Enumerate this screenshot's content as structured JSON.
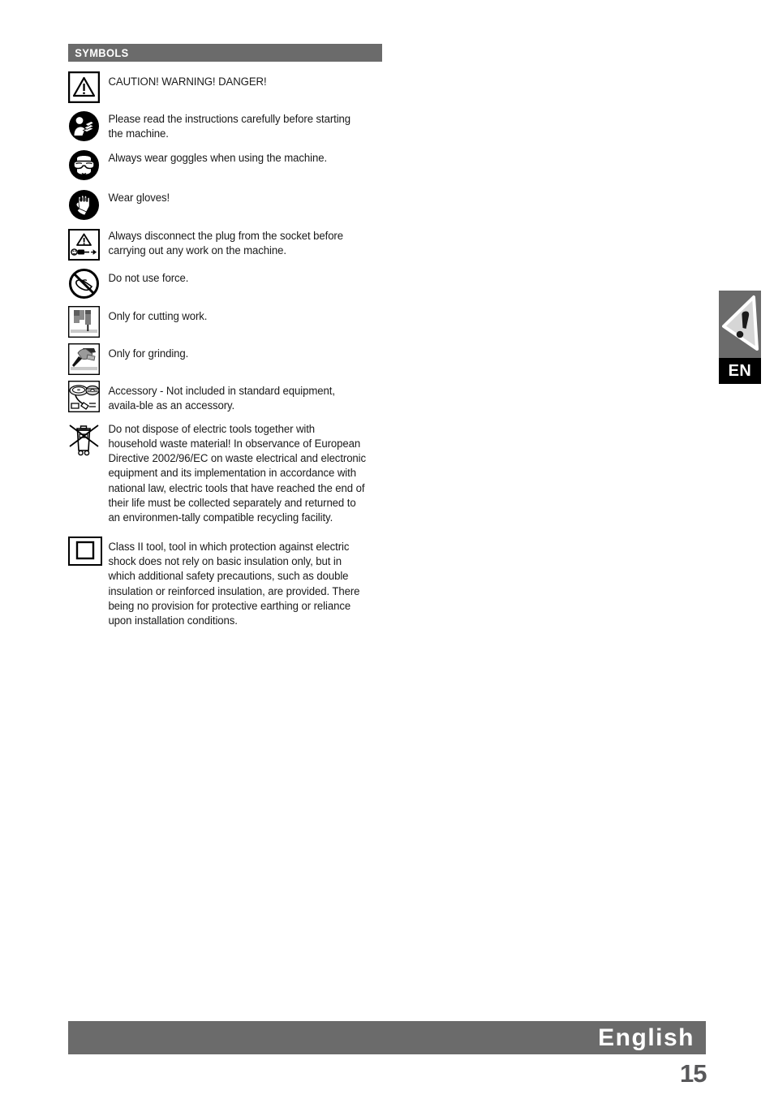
{
  "section": {
    "header_label": "SYMBOLS"
  },
  "symbols": [
    {
      "icon": "warning-triangle-boxed-icon",
      "text": "CAUTION! WARNING! DANGER!"
    },
    {
      "icon": "read-instructions-icon",
      "text": "Please read the instructions carefully before starting the machine."
    },
    {
      "icon": "wear-goggles-icon",
      "text": "Always wear goggles when using the machine."
    },
    {
      "icon": "wear-gloves-icon",
      "text": "Wear gloves!"
    },
    {
      "icon": "disconnect-plug-icon",
      "text": "Always disconnect the plug from the socket before carrying out any work on the machine."
    },
    {
      "icon": "do-not-use-force-icon",
      "text": "Do not use force."
    },
    {
      "icon": "cutting-work-icon",
      "text": "Only for cutting work."
    },
    {
      "icon": "grinding-icon",
      "text": "Only for grinding."
    },
    {
      "icon": "accessory-discs-icon",
      "text": "Accessory - Not included in standard equipment, availa-ble as an accessory."
    },
    {
      "icon": "weee-crossed-bin-icon",
      "text": "Do not dispose of electric tools together with household waste material! In observance of European Directive 2002/96/EC on waste electrical and electronic equipment and its implementation in accordance with national law, electric tools that have reached the end of their life must be collected separately and returned to an environmen-tally compatible recycling facility."
    },
    {
      "icon": "class-ii-double-square-icon",
      "text": "Class II tool, tool in which protection against electric shock does not rely on basic insulation only, but in which additional safety precautions, such as double insulation or reinforced insulation, are provided. There being no provision for protective earthing or reliance upon installation conditions."
    }
  ],
  "language_tab": {
    "code": "EN"
  },
  "footer": {
    "language_title": "English",
    "page_number": "15"
  },
  "colors": {
    "bar_gray": "#6b6b6b",
    "page_number_gray": "#58585a",
    "text_black": "#1a1a1a"
  }
}
